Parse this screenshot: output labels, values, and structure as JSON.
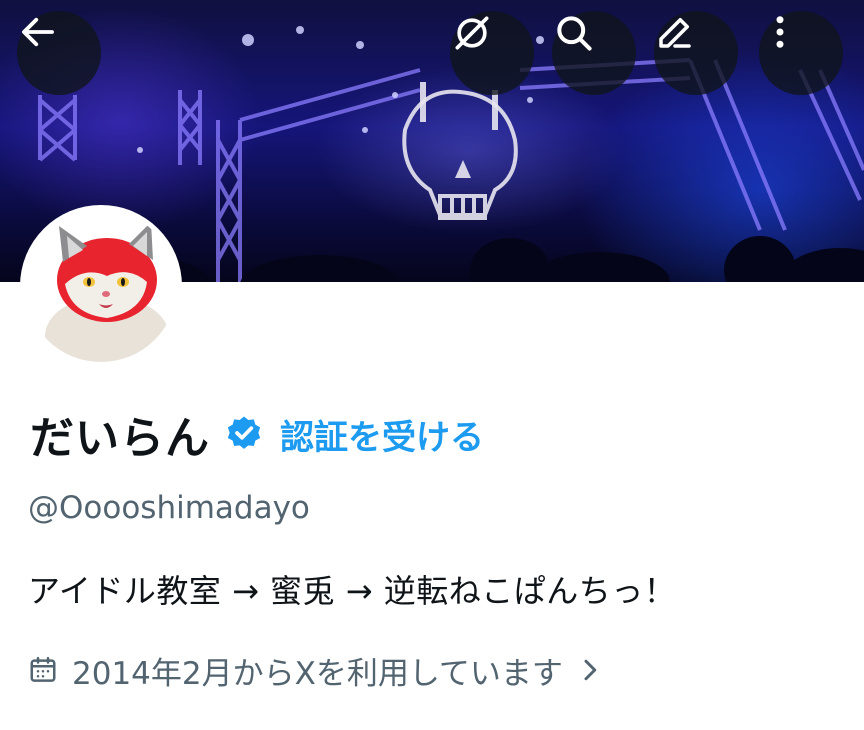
{
  "header": {
    "back_icon": "arrow-left-icon",
    "grok_icon": "grok-icon",
    "search_icon": "search-icon",
    "edit_icon": "edit-pencil-icon",
    "more_icon": "more-vertical-icon"
  },
  "profile": {
    "display_name": "だいらん",
    "verified_icon": "verified-badge-icon",
    "get_verified_label": "認証を受ける",
    "handle": "@Ooooshimadayo",
    "bio": "アイドル教室 → 蜜兎 → 逆転ねこぱんちっ！",
    "joined_text": "2014年2月からXを利用しています",
    "calendar_icon": "calendar-icon",
    "chevron_icon": "chevron-right-icon"
  },
  "colors": {
    "accent": "#1d9bf0",
    "text_primary": "#0f1419",
    "text_secondary": "#536471"
  }
}
